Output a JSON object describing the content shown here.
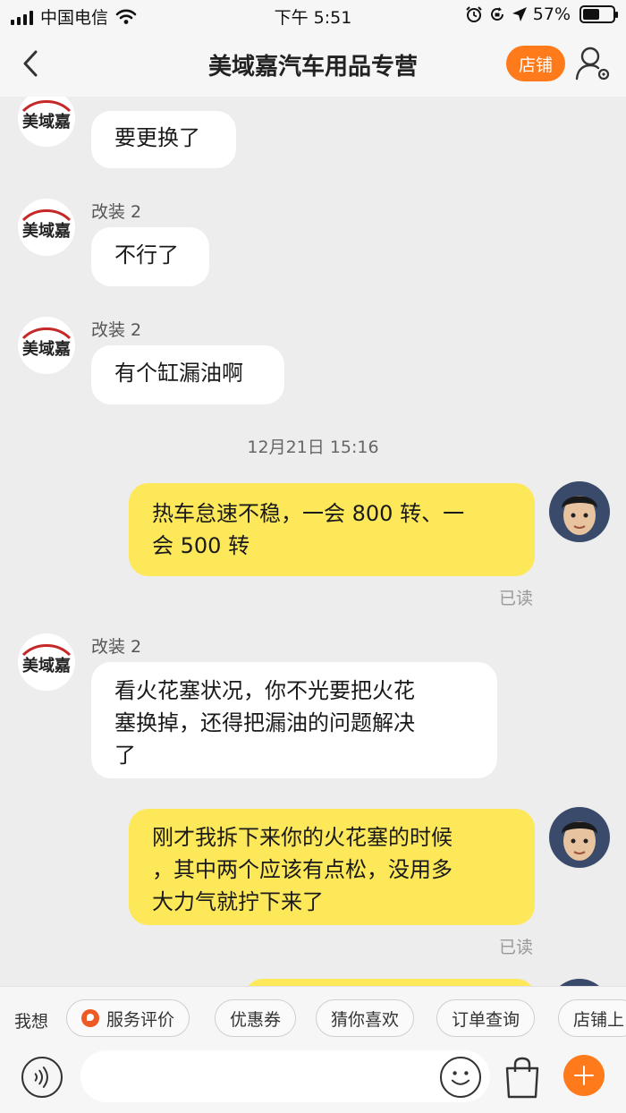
{
  "status_bar": {
    "carrier": "中国电信",
    "time": "下午 5:51",
    "battery": "57%",
    "battery_level": 0.57
  },
  "nav": {
    "title": "美域嘉汽车用品专营",
    "shop_button": "店铺"
  },
  "shop_avatar_logo": "美域嘉",
  "messages": [
    {
      "side": "in",
      "sender": "",
      "text": "要更换了"
    },
    {
      "side": "in",
      "sender": "改装 2",
      "text": "不行了"
    },
    {
      "side": "in",
      "sender": "改装 2",
      "text": "有个缸漏油啊"
    },
    {
      "type": "timestamp",
      "text": "12月21日 15:16"
    },
    {
      "side": "out",
      "lines": [
        "热车怠速不稳，一会 800 转、一",
        "会 500 转"
      ],
      "status": "已读"
    },
    {
      "side": "in",
      "sender": "改装 2",
      "lines": [
        "看火花塞状况，你不光要把火花",
        "塞换掉，还得把漏油的问题解决",
        "了"
      ]
    },
    {
      "side": "out",
      "lines": [
        "刚才我拆下来你的火花塞的时候",
        "，其中两个应该有点松，没用多",
        "大力气就拧下来了"
      ],
      "status": "已读"
    }
  ],
  "quick_bar": {
    "label": "我想",
    "chips": [
      "服务评价",
      "优惠券",
      "猜你喜欢",
      "订单查询",
      "店铺上"
    ]
  },
  "input": {
    "placeholder": ""
  },
  "colors": {
    "accent": "#ff7a1a",
    "out_bubble": "#fde85a",
    "in_bubble": "#ffffff",
    "background": "#ededed"
  },
  "icons": [
    "back-arrow-icon",
    "profile-settings-icon",
    "voice-icon",
    "emoji-icon",
    "shopping-bag-icon",
    "plus-icon",
    "wifi-icon",
    "alarm-icon",
    "rotation-lock-icon",
    "location-icon"
  ]
}
